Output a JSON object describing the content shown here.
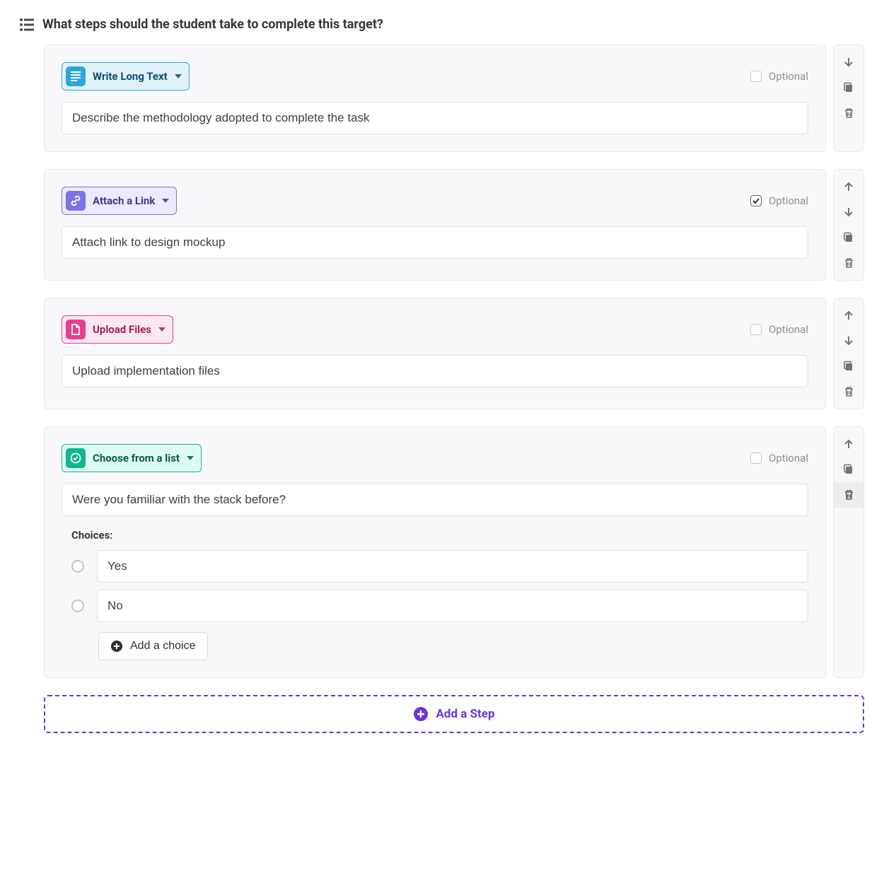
{
  "title": "What steps should the student take to complete this target?",
  "labels": {
    "optional": "Optional",
    "choices": "Choices:",
    "add_choice": "Add a choice",
    "add_step": "Add a Step"
  },
  "steps": [
    {
      "type_label": "Write Long Text",
      "value": "Describe the methodology adopted to complete the task",
      "optional_checked": false,
      "show_up": false,
      "show_down": true
    },
    {
      "type_label": "Attach a Link",
      "value": "Attach link to design mockup",
      "optional_checked": true,
      "show_up": true,
      "show_down": true
    },
    {
      "type_label": "Upload Files",
      "value": "Upload implementation files",
      "optional_checked": false,
      "show_up": true,
      "show_down": true
    },
    {
      "type_label": "Choose from a list",
      "value": "Were you familiar with the stack before?",
      "optional_checked": false,
      "show_up": true,
      "show_down": false,
      "choices": [
        "Yes",
        "No"
      ]
    }
  ]
}
